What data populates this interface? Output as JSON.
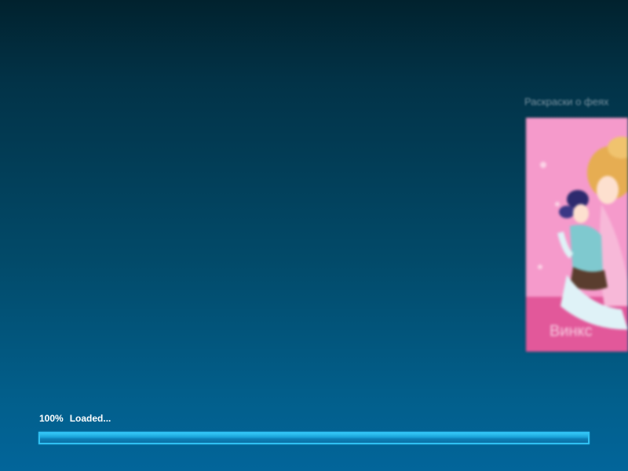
{
  "promo": {
    "caption": "Раскраски о феях",
    "title": "Винкс",
    "icon": "promo-image"
  },
  "loader": {
    "percent_text": "100%",
    "status_text": "Loaded...",
    "progress": 1.0,
    "colors": {
      "border": "#2fc0f2",
      "fill": "#1aa3d9",
      "track": "#06628f"
    }
  },
  "colors": {
    "background_top": "#01222e",
    "background_bottom": "#02659a",
    "promo_pink": "#f48cc3"
  }
}
